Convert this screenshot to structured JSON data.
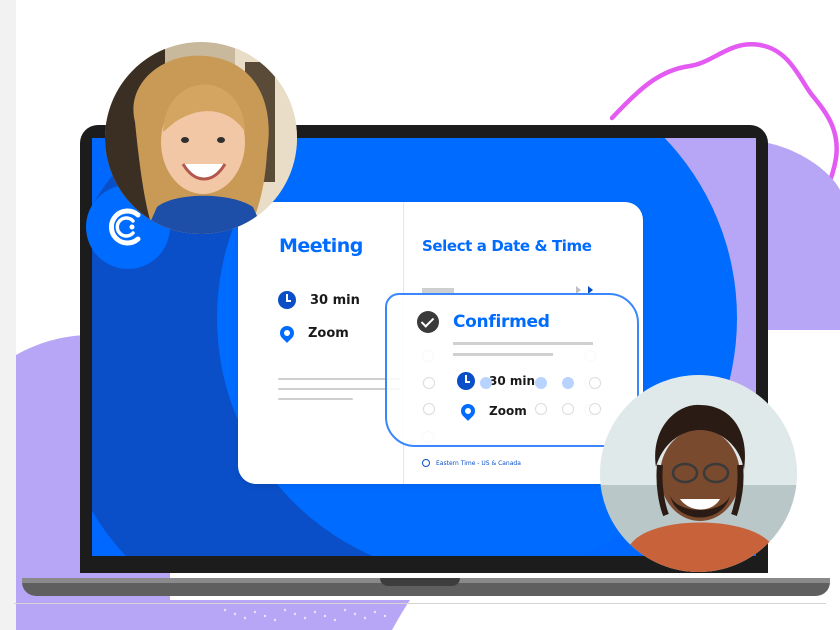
{
  "booking": {
    "event_title": "Meeting",
    "duration": "30 min",
    "location": "Zoom",
    "scheduler_title": "Select a Date & Time",
    "timezone": "Eastern Time - US & Canada"
  },
  "confirmation": {
    "status": "Confirmed",
    "duration": "30 min",
    "location": "Zoom"
  },
  "icons": {
    "logo": "calendly-c-logo-icon",
    "duration": "clock-icon",
    "location": "location-pin-icon",
    "status": "check-circle-icon",
    "timezone": "globe-icon"
  },
  "colors": {
    "brand_blue": "#006bff",
    "dark_blue": "#0a4fc7",
    "lavender": "#b7a5f5",
    "magenta_outline": "#e35bf2",
    "laptop": "#1c1c1c"
  }
}
